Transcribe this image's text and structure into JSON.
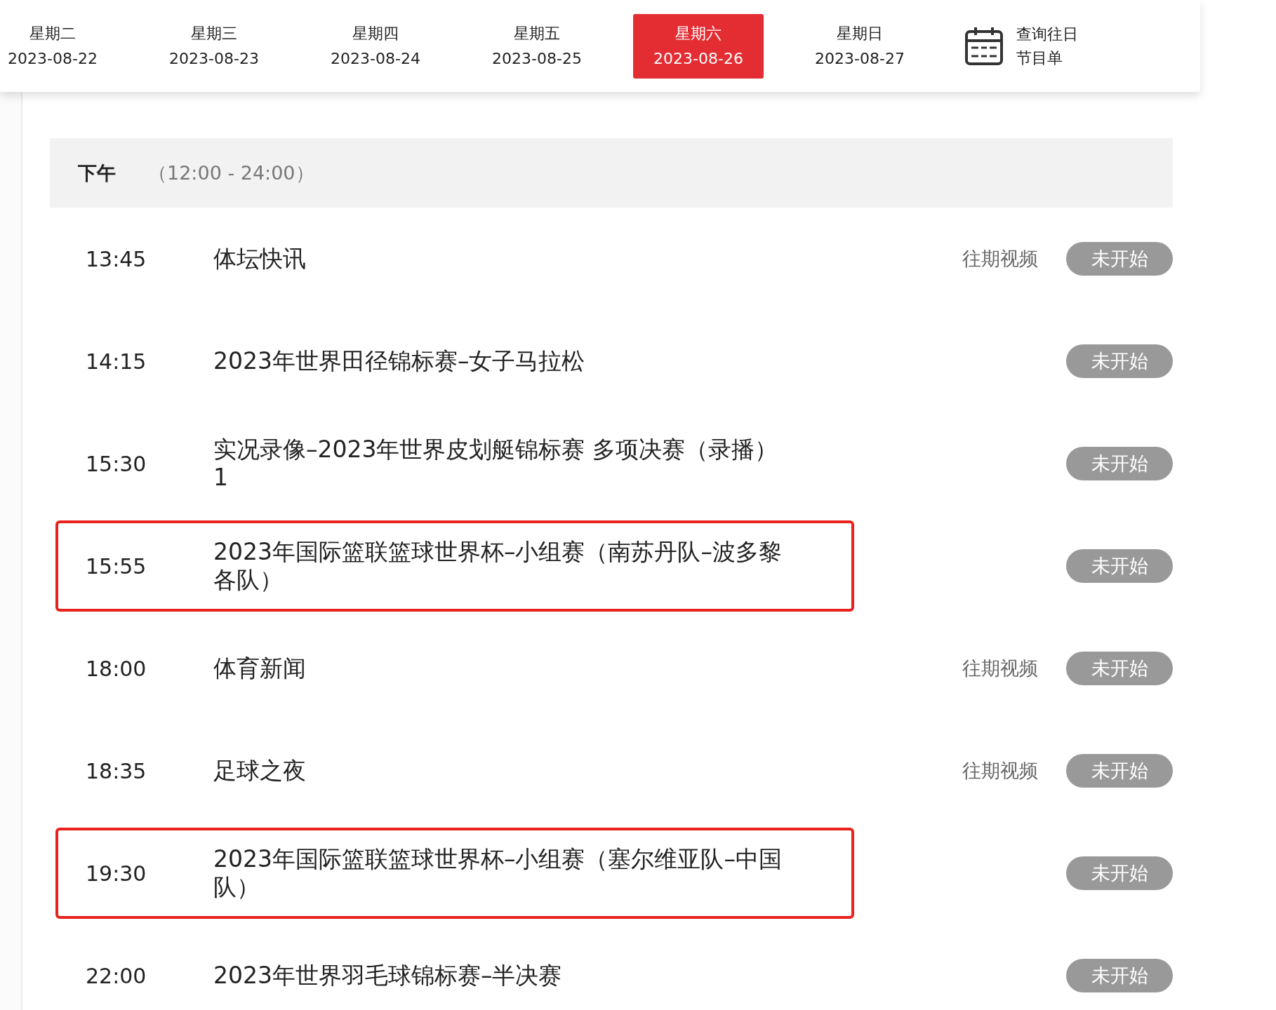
{
  "date_tabs": [
    {
      "weekday": "星期二",
      "date": "2023-08-22",
      "selected": false
    },
    {
      "weekday": "星期三",
      "date": "2023-08-23",
      "selected": false
    },
    {
      "weekday": "星期四",
      "date": "2023-08-24",
      "selected": false
    },
    {
      "weekday": "星期五",
      "date": "2023-08-25",
      "selected": false
    },
    {
      "weekday": "星期六",
      "date": "2023-08-26",
      "selected": true
    },
    {
      "weekday": "星期日",
      "date": "2023-08-27",
      "selected": false
    }
  ],
  "history_link": {
    "lines": [
      "查询往日",
      "节目单"
    ]
  },
  "section": {
    "title": "下午",
    "range": "（12:00 - 24:00）"
  },
  "programs": [
    {
      "time": "13:45",
      "title": "体坛快讯",
      "replay": "往期视频",
      "status": "未开始",
      "highlighted": false
    },
    {
      "time": "14:15",
      "title": "2023年世界田径锦标赛–女子马拉松",
      "status": "未开始",
      "highlighted": false
    },
    {
      "time": "15:30",
      "title": "实况录像–2023年世界皮划艇锦标赛 多项决赛（录播）1",
      "status": "未开始",
      "highlighted": false
    },
    {
      "time": "15:55",
      "title": "2023年国际篮联篮球世界杯–小组赛（南苏丹队–波多黎各队）",
      "status": "未开始",
      "highlighted": true
    },
    {
      "time": "18:00",
      "title": "体育新闻",
      "replay": "往期视频",
      "status": "未开始",
      "highlighted": false
    },
    {
      "time": "18:35",
      "title": "足球之夜",
      "replay": "往期视频",
      "status": "未开始",
      "highlighted": false
    },
    {
      "time": "19:30",
      "title": "2023年国际篮联篮球世界杯–小组赛（塞尔维亚队–中国队）",
      "status": "未开始",
      "highlighted": true
    },
    {
      "time": "22:00",
      "title": "2023年世界羽毛球锦标赛–半决赛",
      "status": "未开始",
      "highlighted": false
    }
  ]
}
